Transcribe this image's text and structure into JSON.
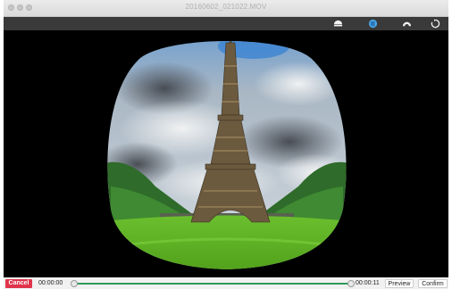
{
  "window": {
    "title": "20160602_021022.MOV"
  },
  "toolbar": {
    "icons": [
      "hemisphere-view-icon",
      "globe-view-icon",
      "dome-view-icon",
      "reset-rotate-icon"
    ]
  },
  "viewer": {
    "content": "fisheye-eiffel-tower-video-frame"
  },
  "playback": {
    "cancel_label": "Cancel",
    "start_time": "00:00:00",
    "end_time": "00:00:11",
    "preview_label": "Preview",
    "confirm_label": "Confirm",
    "progress": 0.0
  },
  "colors": {
    "cancel": "#e0344c",
    "track": "#2f9a5a",
    "toolbar": "#3a3a3a"
  }
}
